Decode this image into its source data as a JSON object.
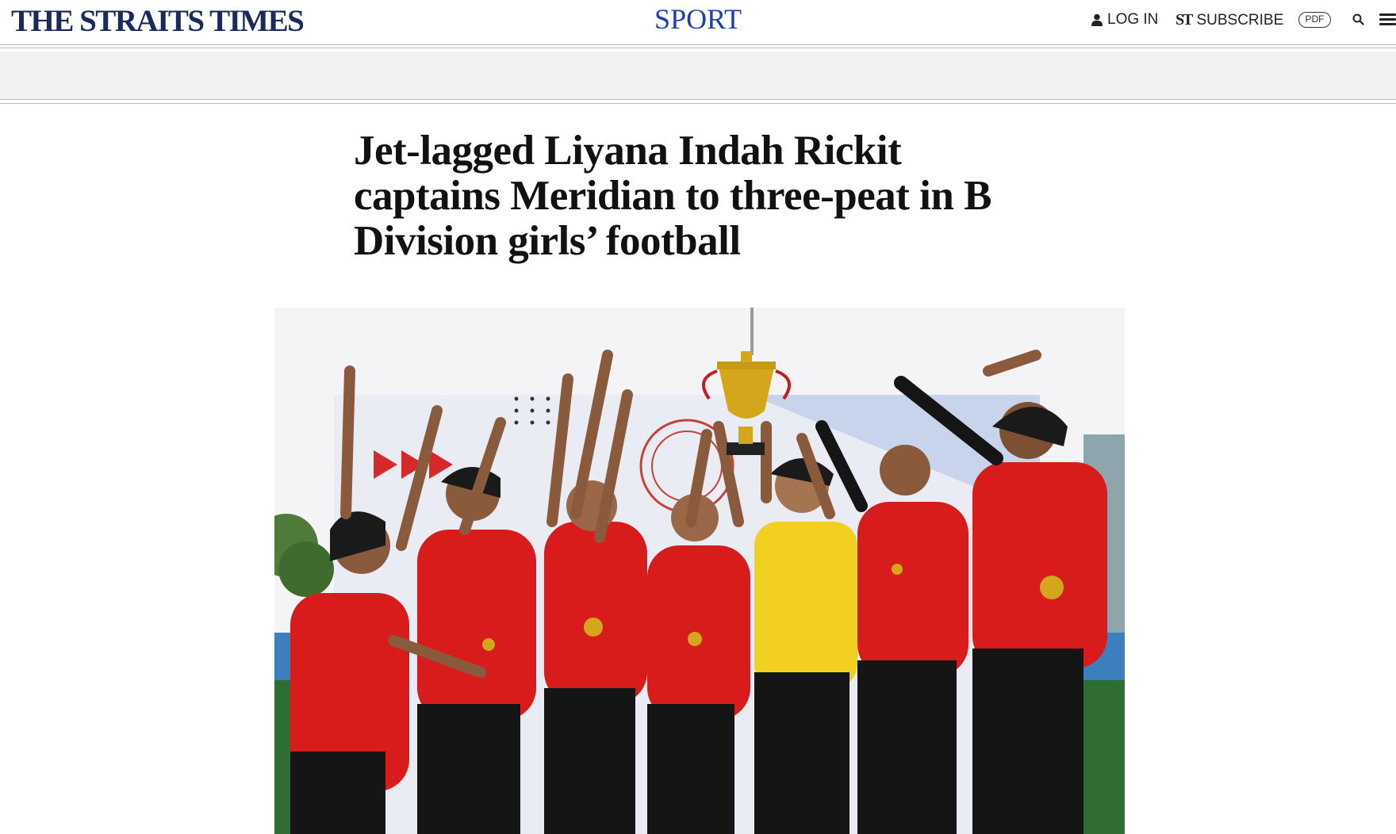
{
  "header": {
    "masthead": "THE STRAITS TIMES",
    "section": "SPORT",
    "login_label": "LOG IN",
    "subscribe_mark": "ST",
    "subscribe_label": "SUBSCRIBE",
    "pdf_label": "PDF",
    "icons": {
      "user": "user-icon",
      "search": "search-icon",
      "menu": "hamburger-menu-icon"
    }
  },
  "article": {
    "headline": "Jet-lagged Liyana Indah Rickit captains Meridian to three-peat in B Division girls’ football"
  },
  "colors": {
    "masthead": "#1a2a5c",
    "section": "#1c3fa8",
    "ad_band": "#f0f2f2",
    "jersey_red": "#d81c1c",
    "keeper_yellow": "#f2d021",
    "trophy_gold": "#d4a61c"
  }
}
